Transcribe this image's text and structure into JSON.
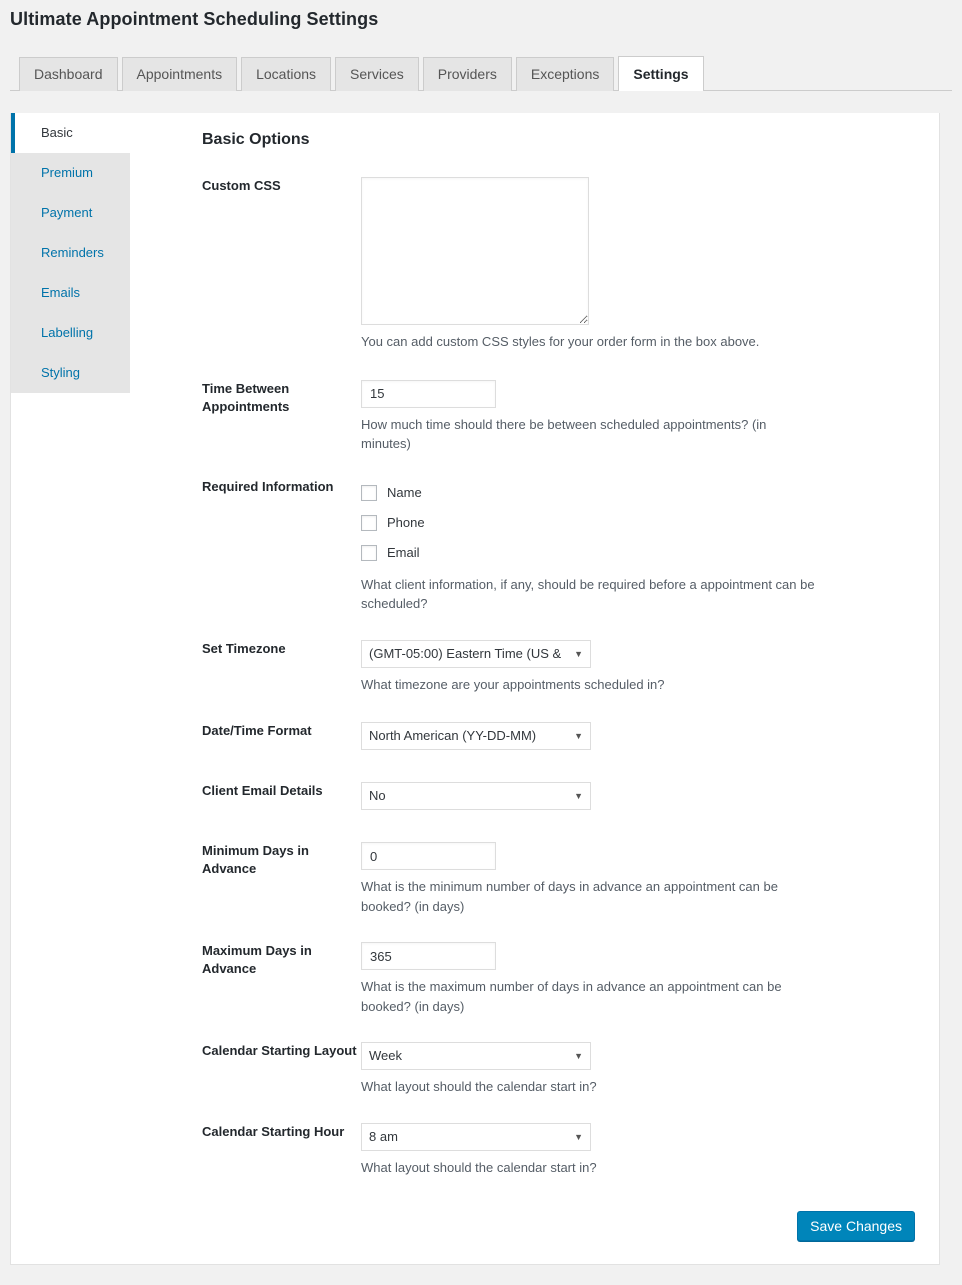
{
  "page": {
    "title": "Ultimate Appointment Scheduling Settings"
  },
  "tabs": [
    {
      "label": "Dashboard",
      "active": false
    },
    {
      "label": "Appointments",
      "active": false
    },
    {
      "label": "Locations",
      "active": false
    },
    {
      "label": "Services",
      "active": false
    },
    {
      "label": "Providers",
      "active": false
    },
    {
      "label": "Exceptions",
      "active": false
    },
    {
      "label": "Settings",
      "active": true
    }
  ],
  "sidebar": {
    "items": [
      {
        "label": "Basic",
        "active": true
      },
      {
        "label": "Premium",
        "active": false
      },
      {
        "label": "Payment",
        "active": false
      },
      {
        "label": "Reminders",
        "active": false
      },
      {
        "label": "Emails",
        "active": false
      },
      {
        "label": "Labelling",
        "active": false
      },
      {
        "label": "Styling",
        "active": false
      }
    ]
  },
  "main": {
    "section_title": "Basic Options",
    "fields": {
      "custom_css": {
        "label": "Custom CSS",
        "value": "",
        "description": "You can add custom CSS styles for your order form in the box above."
      },
      "time_between": {
        "label": "Time Between Appointments",
        "value": "15",
        "description": "How much time should there be between scheduled appointments? (in minutes)"
      },
      "required_information": {
        "label": "Required Information",
        "options": [
          {
            "label": "Name",
            "checked": false
          },
          {
            "label": "Phone",
            "checked": false
          },
          {
            "label": "Email",
            "checked": false
          }
        ],
        "description": "What client information, if any, should be required before a appointment can be scheduled?"
      },
      "set_timezone": {
        "label": "Set Timezone",
        "value": "(GMT-05:00) Eastern Time (US &",
        "description": "What timezone are your appointments scheduled in?"
      },
      "date_time_format": {
        "label": "Date/Time Format",
        "value": "North American (YY-DD-MM)",
        "description": ""
      },
      "client_email_details": {
        "label": "Client Email Details",
        "value": "No",
        "description": ""
      },
      "minimum_days": {
        "label": "Minimum Days in Advance",
        "value": "0",
        "description": "What is the minimum number of days in advance an appointment can be booked? (in days)"
      },
      "maximum_days": {
        "label": "Maximum Days in Advance",
        "value": "365",
        "description": "What is the maximum number of days in advance an appointment can be booked? (in days)"
      },
      "calendar_layout": {
        "label": "Calendar Starting Layout",
        "value": "Week",
        "description": "What layout should the calendar start in?"
      },
      "calendar_hour": {
        "label": "Calendar Starting Hour",
        "value": "8 am",
        "description": "What layout should the calendar start in?"
      }
    },
    "save_label": "Save Changes"
  },
  "icons": {
    "dropdown_arrow": "▼"
  },
  "colors": {
    "accent": "#0073aa",
    "button": "#0085ba",
    "page_bg": "#f1f1f1",
    "sidebar_bg": "#e5e5e5"
  }
}
